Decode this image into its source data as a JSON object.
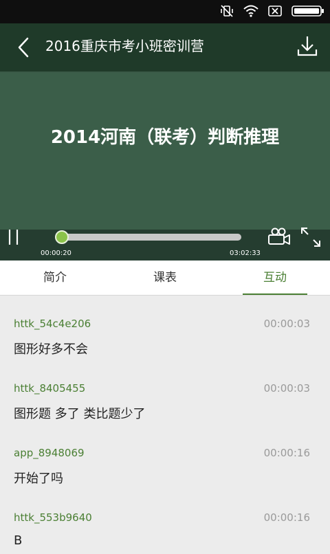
{
  "status_bar": {
    "icons": [
      "mute-vibrate-icon",
      "wifi-icon",
      "no-sim-icon",
      "battery-icon"
    ]
  },
  "player": {
    "course_title": "2016重庆市考小班密训营",
    "lesson_title": "2014河南（联考）判断推理",
    "current_time": "00:00:20",
    "total_time": "03:02:33",
    "progress_fraction": 0.0018,
    "accent_color": "#8bc34a",
    "icons": [
      "back-icon",
      "download-icon",
      "pause-icon",
      "camera-icon",
      "fullscreen-icon"
    ]
  },
  "tabs": [
    {
      "label": "简介"
    },
    {
      "label": "课表"
    },
    {
      "label": "互动",
      "active": true
    }
  ],
  "messages": [
    {
      "user": "httk_54c4e206",
      "time": "00:00:03",
      "text": "图形好多不会"
    },
    {
      "user": "httk_8405455",
      "time": "00:00:03",
      "text": "图形题 多了 类比题少了"
    },
    {
      "user": "app_8948069",
      "time": "00:00:16",
      "text": "开始了吗"
    },
    {
      "user": "httk_553b9640",
      "time": "00:00:16",
      "text": "B"
    }
  ],
  "colors": {
    "active_tab": "#4a7f33",
    "username": "#4a7f33",
    "board": "#3b5e49"
  }
}
